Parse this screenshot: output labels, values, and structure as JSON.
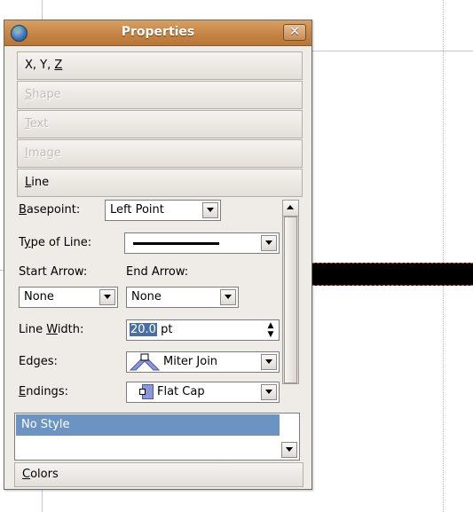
{
  "window": {
    "title": "Properties",
    "close_glyph": "✕"
  },
  "sections": {
    "xyz": {
      "pre": "X, Y, ",
      "mnemonic": "Z",
      "post": ""
    },
    "shape": {
      "pre": "",
      "mnemonic": "S",
      "post": "hape"
    },
    "text": {
      "pre": "",
      "mnemonic": "T",
      "post": "ext"
    },
    "image": {
      "pre": "",
      "mnemonic": "I",
      "post": "mage"
    },
    "line": {
      "pre": "",
      "mnemonic": "L",
      "post": "ine"
    },
    "colors": {
      "pre": "",
      "mnemonic": "C",
      "post": "olors"
    }
  },
  "line_panel": {
    "basepoint": {
      "label_pre": "",
      "mnemonic": "B",
      "label_post": "asepoint:",
      "value": "Left Point"
    },
    "type_of_line": {
      "label_pre": "T",
      "mnemonic": "y",
      "label_post": "pe of Line:"
    },
    "start_arrow": {
      "label": "Start Arrow:",
      "value": "None"
    },
    "end_arrow": {
      "label": "End Arrow:",
      "value": "None"
    },
    "line_width": {
      "label_pre": "Line ",
      "mnemonic": "W",
      "label_post": "idth:",
      "value_selected": "20.0",
      "unit": " pt"
    },
    "edges": {
      "label_pre": "Ed",
      "mnemonic": "g",
      "label_post": "es:",
      "value": "Miter Join"
    },
    "endings": {
      "label_pre": "",
      "mnemonic": "E",
      "label_post": "ndings:",
      "value": "Flat Cap"
    }
  },
  "style_list": {
    "selected": "No Style"
  },
  "icons": {
    "app": "app-globe-icon",
    "close": "close-icon",
    "miter_join": "miter-join-icon",
    "flat_cap": "flat-cap-icon"
  },
  "colors": {
    "titlebar": "#c9894a",
    "selection": "#6b94c2",
    "dialog_bg": "#efebe7"
  }
}
